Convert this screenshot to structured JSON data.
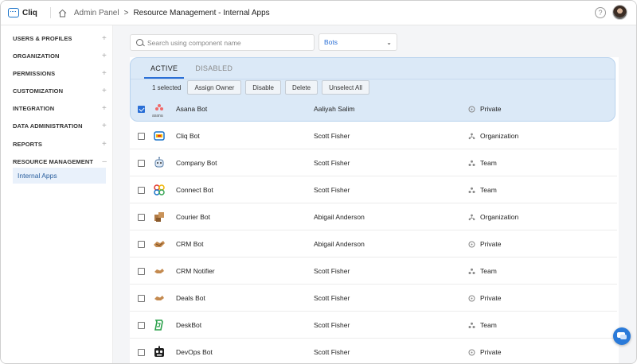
{
  "header": {
    "app_name": "Cliq",
    "breadcrumb_root": "Admin Panel",
    "breadcrumb_separator": ">",
    "breadcrumb_current": "Resource Management - Internal Apps",
    "help_symbol": "?"
  },
  "sidebar": {
    "items": [
      {
        "label": "USERS & PROFILES",
        "toggle": "+"
      },
      {
        "label": "ORGANIZATION",
        "toggle": "+"
      },
      {
        "label": "PERMISSIONS",
        "toggle": "+"
      },
      {
        "label": "CUSTOMIZATION",
        "toggle": "+"
      },
      {
        "label": "INTEGRATION",
        "toggle": "+"
      },
      {
        "label": "DATA ADMINISTRATION",
        "toggle": "+"
      },
      {
        "label": "REPORTS",
        "toggle": "+"
      },
      {
        "label": "RESOURCE MANAGEMENT",
        "toggle": "–"
      }
    ],
    "sub_item": "Internal Apps"
  },
  "filters": {
    "search_placeholder": "Search using component name",
    "type_selected": "Bots"
  },
  "tabs": {
    "active": "ACTIVE",
    "disabled": "DISABLED"
  },
  "toolbar": {
    "selected_count": "1 selected",
    "assign_owner": "Assign Owner",
    "disable": "Disable",
    "delete": "Delete",
    "unselect_all": "Unselect All"
  },
  "rows": [
    {
      "name": "Asana Bot",
      "owner": "Aaliyah Salim",
      "scope": "Private",
      "checked": true,
      "icon": "asana-icon",
      "icon_text": "asana"
    },
    {
      "name": "Cliq Bot",
      "owner": "Scott Fisher",
      "scope": "Organization",
      "checked": false,
      "icon": "cliq-bot-icon"
    },
    {
      "name": "Company Bot",
      "owner": "Scott Fisher",
      "scope": "Team",
      "checked": false,
      "icon": "robot-icon"
    },
    {
      "name": "Connect Bot",
      "owner": "Scott Fisher",
      "scope": "Team",
      "checked": false,
      "icon": "connect-icon"
    },
    {
      "name": "Courier Bot",
      "owner": "Abigail Anderson",
      "scope": "Organization",
      "checked": false,
      "icon": "courier-icon"
    },
    {
      "name": "CRM Bot",
      "owner": "Abigail Anderson",
      "scope": "Private",
      "checked": false,
      "icon": "crm-icon"
    },
    {
      "name": "CRM Notifier",
      "owner": "Scott Fisher",
      "scope": "Team",
      "checked": false,
      "icon": "crm-notifier-icon"
    },
    {
      "name": "Deals Bot",
      "owner": "Scott Fisher",
      "scope": "Private",
      "checked": false,
      "icon": "deals-icon"
    },
    {
      "name": "DeskBot",
      "owner": "Scott Fisher",
      "scope": "Team",
      "checked": false,
      "icon": "desk-icon"
    },
    {
      "name": "DevOps Bot",
      "owner": "Scott Fisher",
      "scope": "Private",
      "checked": false,
      "icon": "devops-icon"
    }
  ],
  "colors": {
    "accent": "#2a6fd6",
    "selection_panel": "#dbe9f7",
    "sidebar_active": "#e9f1fb"
  }
}
